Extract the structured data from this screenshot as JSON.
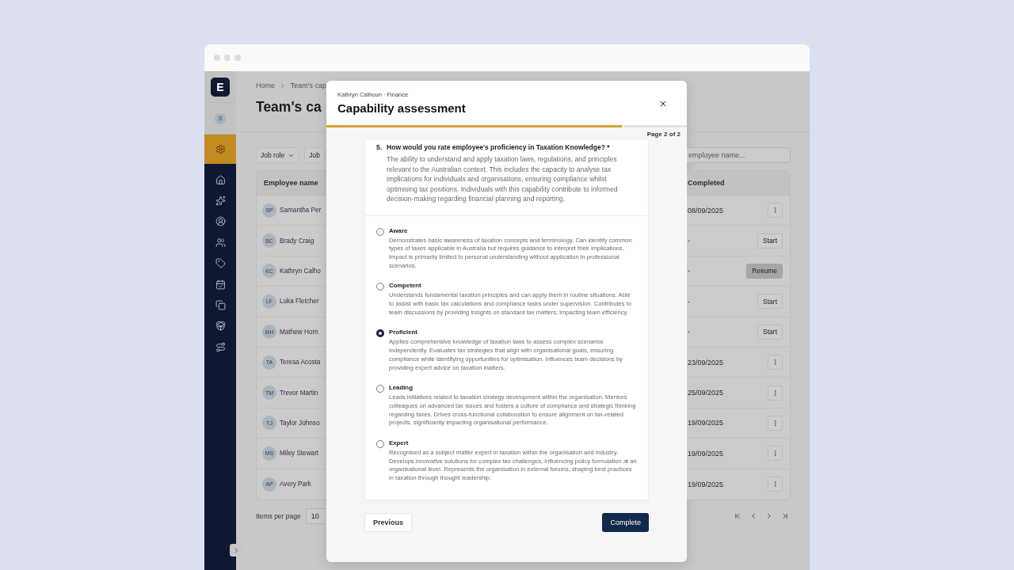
{
  "window": {
    "kind": "browser"
  },
  "sidebar": {
    "logo": "E",
    "avatar": "S",
    "items": [
      {
        "selected": true
      },
      {
        "selected": false
      },
      {
        "selected": false
      },
      {
        "selected": false
      },
      {
        "selected": false
      },
      {
        "selected": false
      },
      {
        "selected": false
      },
      {
        "selected": false
      },
      {
        "selected": false
      },
      {
        "selected": false
      }
    ]
  },
  "page": {
    "breadcrumb": [
      "Home",
      "Team's cap"
    ],
    "title": "Team's ca",
    "filters": [
      "Job role",
      "Job"
    ],
    "search": {
      "placeholder": "employee name..."
    },
    "table": {
      "columns": [
        "Employee name",
        "Completed"
      ],
      "rows": [
        {
          "initials": "SP",
          "name": "Samantha Per",
          "completed": "08/09/2025",
          "action": {
            "kind": "menu"
          }
        },
        {
          "initials": "BC",
          "name": "Brady Craig",
          "completed": "-",
          "action": {
            "kind": "button",
            "label": "Start",
            "highlighted": false
          }
        },
        {
          "initials": "KC",
          "name": "Kathryn Calho",
          "completed": "-",
          "action": {
            "kind": "button",
            "label": "Resume",
            "highlighted": true
          }
        },
        {
          "initials": "LF",
          "name": "Luka Fletcher",
          "completed": "-",
          "action": {
            "kind": "button",
            "label": "Start",
            "highlighted": false
          }
        },
        {
          "initials": "MH",
          "name": "Mathew Horn",
          "completed": "-",
          "action": {
            "kind": "button",
            "label": "Start",
            "highlighted": false
          }
        },
        {
          "initials": "TA",
          "name": "Teresa Acosta",
          "completed": "23/09/2025",
          "action": {
            "kind": "menu"
          }
        },
        {
          "initials": "TM",
          "name": "Trevor Martin",
          "completed": "25/09/2025",
          "action": {
            "kind": "menu"
          }
        },
        {
          "initials": "TJ",
          "name": "Taylor Johnso",
          "completed": "19/09/2025",
          "action": {
            "kind": "menu"
          }
        },
        {
          "initials": "MS",
          "name": "Miley Stewart",
          "completed": "19/09/2025",
          "action": {
            "kind": "menu"
          }
        },
        {
          "initials": "AP",
          "name": "Avery Park",
          "completed": "19/09/2025",
          "action": {
            "kind": "menu"
          }
        }
      ]
    },
    "pagination": {
      "label": "Items per page",
      "value": "10"
    }
  },
  "modal": {
    "subtitle": "Kathryn Calhoun · Finance",
    "title": "Capability assessment",
    "progress": {
      "level": 0.82
    },
    "page_label": "Page 2 of 2",
    "question": {
      "number": "5.",
      "text": "How would you rate employee's proficiency in Taxation Knowledge? *",
      "description": "The ability to understand and apply taxation laws, regulations, and principles relevant to the Australian context. This includes the capacity to analyse tax implications for individuals and organisations, ensuring compliance whilst optimising tax positions. Individuals with this capability contribute to informed decision-making regarding financial planning and reporting."
    },
    "options": [
      {
        "label": "Aware",
        "description": "Demonstrates basic awareness of taxation concepts and terminology. Can identify common types of taxes applicable in Australia but requires guidance to interpret their implications. Impact is primarily limited to personal understanding without application in professional scenarios.",
        "selected": false
      },
      {
        "label": "Competent",
        "description": "Understands fundamental taxation principles and can apply them in routine situations. Able to assist with basic tax calculations and compliance tasks under supervision. Contributes to team discussions by providing insights on standard tax matters, impacting team efficiency.",
        "selected": false
      },
      {
        "label": "Proficient",
        "description": "Applies comprehensive knowledge of taxation laws to assess complex scenarios independently. Evaluates tax strategies that align with organisational goals, ensuring compliance while identifying opportunities for optimisation. Influences team decisions by providing expert advice on taxation matters.",
        "selected": true
      },
      {
        "label": "Leading",
        "description": "Leads initiatives related to taxation strategy development within the organisation. Mentors colleagues on advanced tax issues and fosters a culture of compliance and strategic thinking regarding taxes. Drives cross-functional collaboration to ensure alignment on tax-related projects, significantly impacting organisational performance.",
        "selected": false
      },
      {
        "label": "Expert",
        "description": "Recognised as a subject matter expert in taxation within the organisation and industry. Develops innovative solutions for complex tax challenges, influencing policy formulation at an organisational level. Represents the organisation in external forums, shaping best practices in taxation through thought leadership.",
        "selected": false
      }
    ],
    "buttons": {
      "previous": "Previous",
      "complete": "Complete"
    }
  }
}
